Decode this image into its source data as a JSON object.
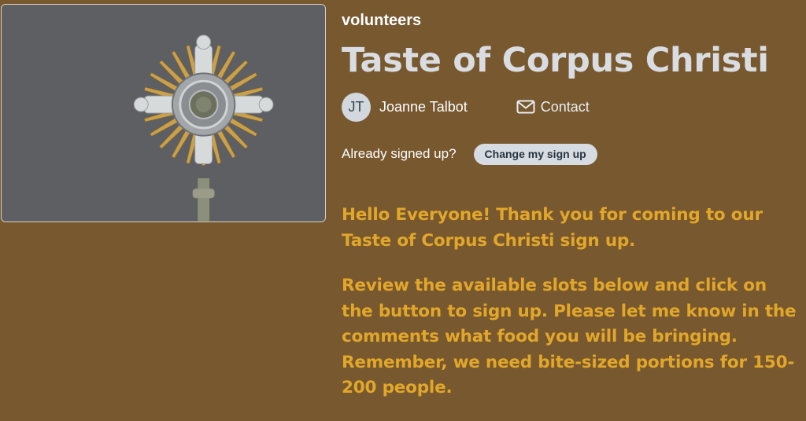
{
  "header": {
    "category": "volunteers",
    "title": "Taste of Corpus Christi"
  },
  "organizer": {
    "initials": "JT",
    "name": "Joanne Talbot",
    "contact_label": "Contact",
    "contact_icon": "envelope-icon"
  },
  "signup": {
    "prompt": "Already signed up?",
    "change_button": "Change my sign up"
  },
  "description": {
    "paragraph1": "Hello Everyone! Thank you for coming to our Taste of Corpus Christi sign up.",
    "paragraph2": "Review the available slots below and click on the button to sign up. Please let me know in the comments what food you will be bringing. Remember, we need bite-sized portions for 150-200 people."
  },
  "colors": {
    "background": "#77582f",
    "title": "#d9dde1",
    "description_text": "#e2a72a",
    "button_bg": "#d6dce1"
  }
}
